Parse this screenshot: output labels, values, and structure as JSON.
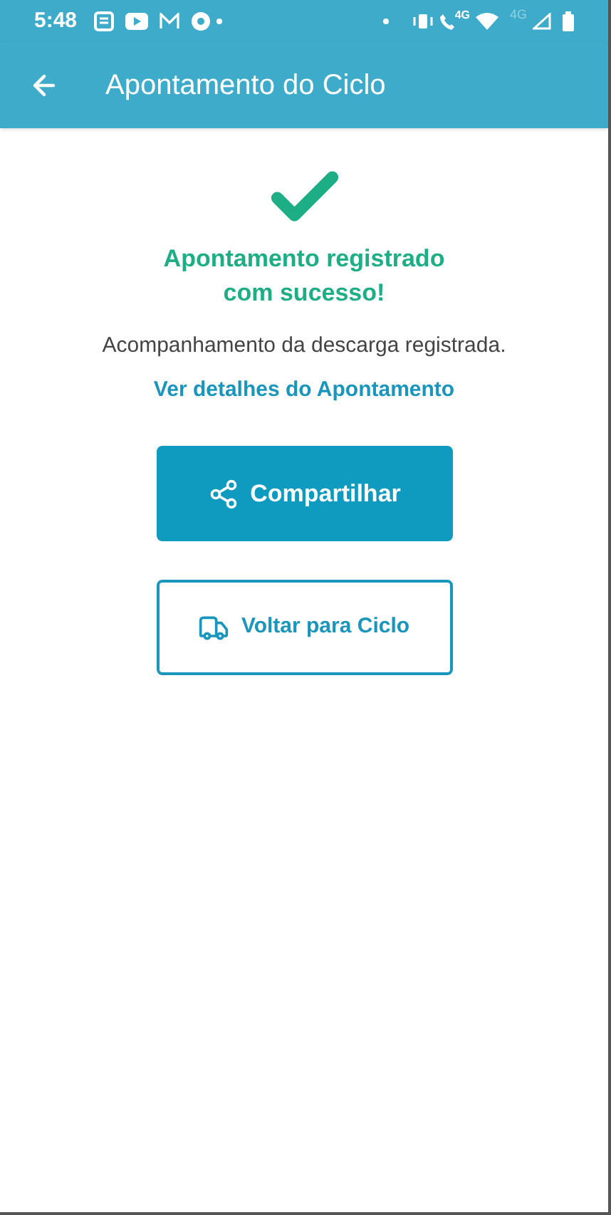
{
  "status_bar": {
    "time": "5:48",
    "call_network": "4G",
    "mobile_network": "4G"
  },
  "app_bar": {
    "title": "Apontamento do Ciclo"
  },
  "success": {
    "title": "Apontamento registrado com sucesso!",
    "message": "Acompanhamento da descarga registrada.",
    "link": "Ver detalhes do Apontamento"
  },
  "buttons": [
    {
      "kind": "primary",
      "label": "Compartilhar"
    },
    {
      "kind": "outline",
      "label": "Voltar para Ciclo"
    }
  ]
}
